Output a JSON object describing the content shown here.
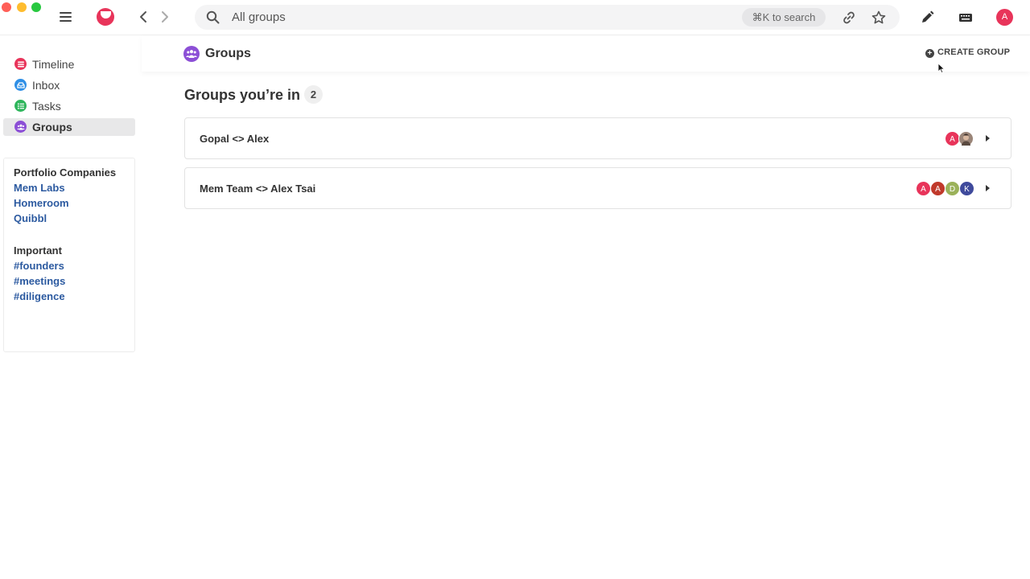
{
  "topbar": {
    "search": {
      "placeholder": "All groups",
      "value": "",
      "shortcut": "⌘K to search"
    },
    "user_avatar": "A"
  },
  "sidebar": {
    "nav": [
      {
        "label": "Timeline",
        "color": "#e8345a",
        "icon": "timeline-icon",
        "active": false
      },
      {
        "label": "Inbox",
        "color": "#2f8fe6",
        "icon": "inbox-icon",
        "active": false
      },
      {
        "label": "Tasks",
        "color": "#2fb65c",
        "icon": "tasks-icon",
        "active": false
      },
      {
        "label": "Groups",
        "color": "#8c4fd6",
        "icon": "groups-icon",
        "active": true
      }
    ],
    "sections": [
      {
        "title": "Portfolio Companies",
        "links": [
          "Mem Labs",
          "Homeroom",
          "Quibbl"
        ]
      },
      {
        "title": "Important",
        "links": [
          "#founders",
          "#meetings",
          "#diligence"
        ]
      }
    ]
  },
  "main": {
    "title": "Groups",
    "create_label": "CREATE GROUP",
    "section_title": "Groups you’re in",
    "count": "2",
    "groups": [
      {
        "name": "Gopal <> Alex",
        "members": [
          {
            "initial": "A",
            "color": "#e8345a"
          },
          {
            "initial": "",
            "color": "#9a8578"
          }
        ]
      },
      {
        "name": "Mem Team <> Alex Tsai",
        "members": [
          {
            "initial": "A",
            "color": "#e8345a"
          },
          {
            "initial": "A",
            "color": "#c0392b"
          },
          {
            "initial": "D",
            "color": "#9bb25a"
          },
          {
            "initial": "K",
            "color": "#3f4a9c"
          }
        ]
      }
    ]
  }
}
